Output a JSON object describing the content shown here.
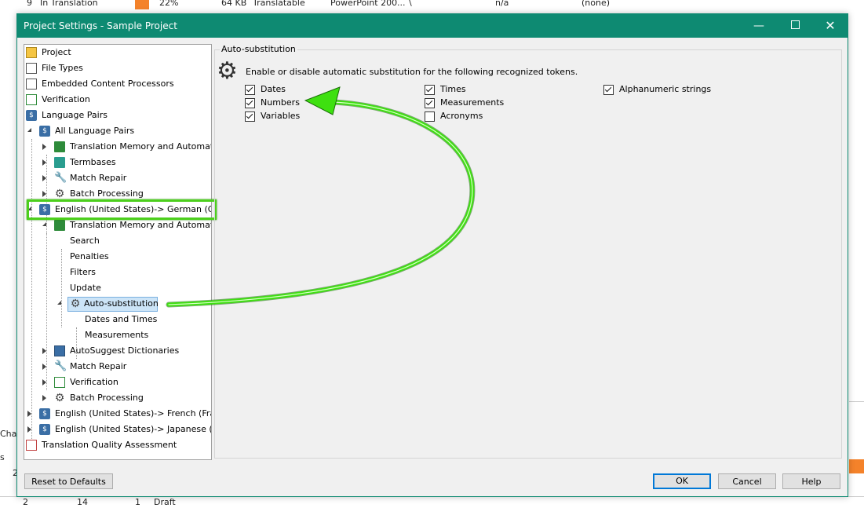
{
  "background": {
    "row_number": "9",
    "row_status": "In Translation",
    "row_percent": "22%",
    "row_size": "64 KB",
    "row_type": "Translatable",
    "row_filetype": "PowerPoint 200...",
    "row_backslash": "\\",
    "row_na": "n/a",
    "row_none": "(none)",
    "left_cha": "Cha",
    "left_s": "s",
    "left_2": "2",
    "bottom_num": "2",
    "bottom_val": "14",
    "bottom_val2": "1",
    "bottom_draft": "Draft"
  },
  "dialog": {
    "title": "Project Settings - Sample Project",
    "minimize": "—",
    "close": "✕"
  },
  "tree": {
    "project": "Project",
    "file_types": "File Types",
    "embedded": "Embedded Content Processors",
    "verification": "Verification",
    "language_pairs": "Language Pairs",
    "all_language_pairs": "All Language Pairs",
    "tm_automated": "Translation Memory and Automate",
    "termbases": "Termbases",
    "match_repair": "Match Repair",
    "batch_processing": "Batch Processing",
    "en_de": "English (United States)-> German (Ger",
    "tm_automated_2": "Translation Memory and Automate",
    "search": "Search",
    "penalties": "Penalties",
    "filters": "Filters",
    "update": "Update",
    "auto_substitution": "Auto-substitution",
    "dates_times": "Dates and Times",
    "measurements": "Measurements",
    "autosuggest": "AutoSuggest Dictionaries",
    "match_repair_2": "Match Repair",
    "verification_2": "Verification",
    "batch_processing_2": "Batch Processing",
    "en_fr": "English (United States)-> French (Franc",
    "en_ja": "English (United States)-> Japanese (Jap",
    "tqa": "Translation Quality Assessment"
  },
  "panel": {
    "group_title": "Auto-substitution",
    "description": "Enable or disable automatic substitution for the following recognized tokens.",
    "options": {
      "dates": {
        "label": "Dates",
        "checked": true
      },
      "numbers": {
        "label": "Numbers",
        "checked": true
      },
      "variables": {
        "label": "Variables",
        "checked": true
      },
      "times": {
        "label": "Times",
        "checked": true
      },
      "measurements": {
        "label": "Measurements",
        "checked": true
      },
      "acronyms": {
        "label": "Acronyms",
        "checked": false
      },
      "alphanumeric": {
        "label": "Alphanumeric strings",
        "checked": true
      }
    }
  },
  "buttons": {
    "reset": "Reset to Defaults",
    "ok": "OK",
    "cancel": "Cancel",
    "help": "Help"
  },
  "colors": {
    "titlebar": "#0e8a72",
    "highlight": "#4ccf1c",
    "arrow": "#3ee010",
    "selection": "#cce4f7"
  }
}
